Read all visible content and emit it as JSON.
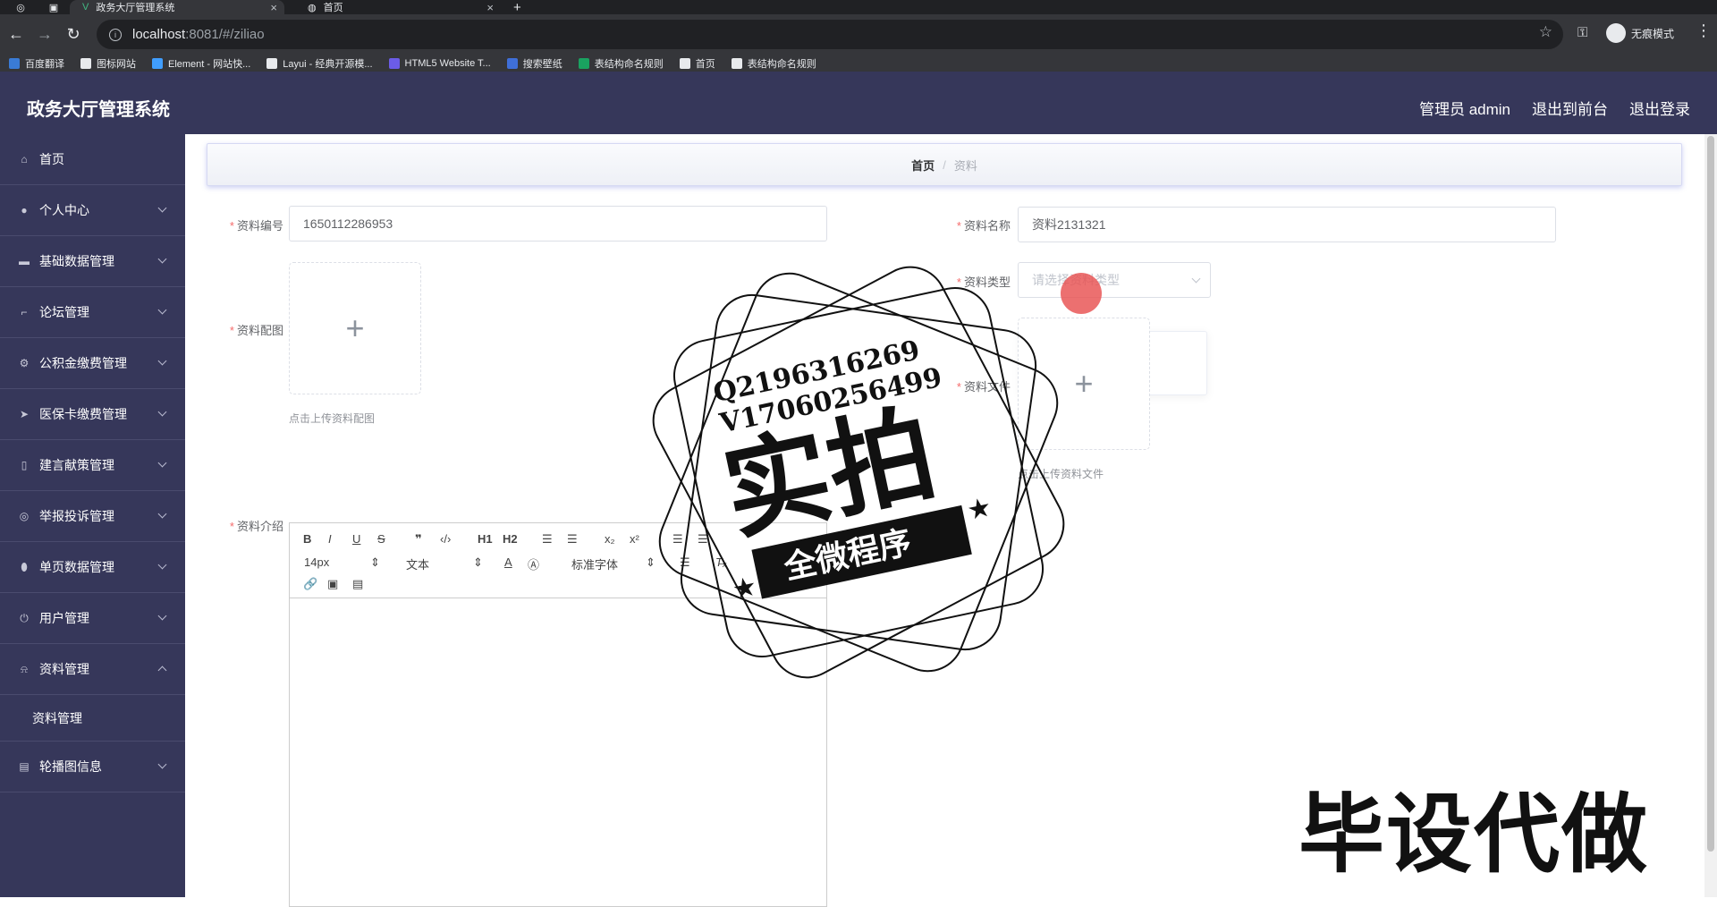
{
  "browser": {
    "tabs": [
      {
        "title": "政务大厅管理系统",
        "active": true
      },
      {
        "title": "首页",
        "active": false
      }
    ],
    "url_host": "localhost",
    "url_path": ":8081/#/ziliao",
    "incognito_label": "无痕模式",
    "bookmarks": [
      {
        "label": "百度翻译",
        "color": "#3a7bd5"
      },
      {
        "label": "图标网站",
        "color": "#e8eaed"
      },
      {
        "label": "Element - 网站快...",
        "color": "#409eff"
      },
      {
        "label": "Layui - 经典开源模...",
        "color": "#e8eaed"
      },
      {
        "label": "HTML5 Website T...",
        "color": "#6b5ce7"
      },
      {
        "label": "搜索壁纸",
        "color": "#3f6fd8"
      },
      {
        "label": "表结构命名规则",
        "color": "#1aa260"
      },
      {
        "label": "首页",
        "color": "#e8eaed"
      },
      {
        "label": "表结构命名规则",
        "color": "#e8eaed"
      }
    ]
  },
  "header": {
    "title": "政务大厅管理系统",
    "links": [
      "管理员 admin",
      "退出到前台",
      "退出登录"
    ]
  },
  "sidebar": {
    "items": [
      {
        "label": "首页",
        "icon": "home-icon",
        "has_children": false
      },
      {
        "label": "个人中心",
        "icon": "user-icon",
        "has_children": true
      },
      {
        "label": "基础数据管理",
        "icon": "database-icon",
        "has_children": true
      },
      {
        "label": "论坛管理",
        "icon": "crop-icon",
        "has_children": true
      },
      {
        "label": "公积金缴费管理",
        "icon": "settings-icon",
        "has_children": true
      },
      {
        "label": "医保卡缴费管理",
        "icon": "send-icon",
        "has_children": true
      },
      {
        "label": "建言献策管理",
        "icon": "mobile-icon",
        "has_children": true
      },
      {
        "label": "举报投诉管理",
        "icon": "target-icon",
        "has_children": true
      },
      {
        "label": "单页数据管理",
        "icon": "location-icon",
        "has_children": true
      },
      {
        "label": "用户管理",
        "icon": "power-icon",
        "has_children": true
      },
      {
        "label": "资料管理",
        "icon": "bell-icon",
        "has_children": true,
        "expanded": true,
        "children": [
          "资料管理"
        ]
      },
      {
        "label": "轮播图信息",
        "icon": "clipboard-icon",
        "has_children": true
      }
    ]
  },
  "breadcrumb": {
    "home": "首页",
    "separator": "/",
    "current": "资料"
  },
  "form": {
    "code_label": "资料编号",
    "code_value": "1650112286953",
    "name_label": "资料名称",
    "name_value": "资料2131321",
    "picture_label": "资料配图",
    "picture_tip": "点击上传资料配图",
    "type_label": "资料类型",
    "type_placeholder": "请选择资料类型",
    "file_label": "资料文件",
    "file_tip": "点击上传资料文件",
    "intro_label": "资料介绍"
  },
  "editor": {
    "font_size": "14px",
    "heading": "文本",
    "font_family": "标准字体",
    "h1": "H1",
    "h2": "H2"
  },
  "overlay": {
    "stamp_line1": "Q2196316269",
    "stamp_line2": "V17060256499",
    "stamp_big": "实拍",
    "stamp_banner": "全微程序",
    "caption": "毕设代做"
  }
}
